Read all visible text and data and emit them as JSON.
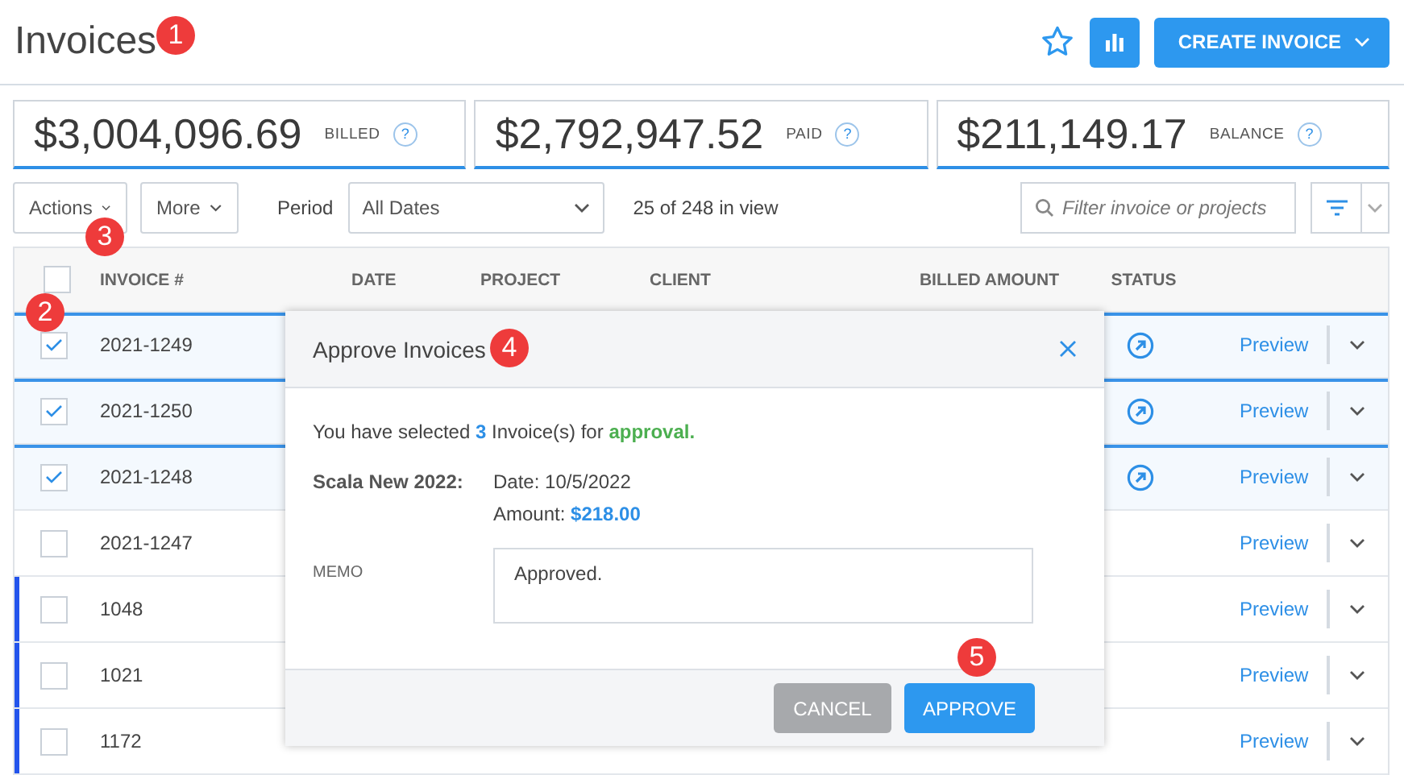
{
  "header": {
    "title": "Invoices",
    "favorite": false,
    "create_button": "CREATE INVOICE"
  },
  "stats": [
    {
      "amount": "$3,004,096.69",
      "label": "BILLED",
      "help": "?"
    },
    {
      "amount": "$2,792,947.52",
      "label": "PAID",
      "help": "?"
    },
    {
      "amount": "$211,149.17",
      "label": "BALANCE",
      "help": "?"
    }
  ],
  "toolbar": {
    "actions": "Actions",
    "more": "More",
    "period_label": "Period",
    "period_value": "All Dates",
    "count": "25 of 248 in view",
    "search": {
      "placeholder": "Filter invoice or projects"
    }
  },
  "table": {
    "header_checked": false,
    "columns": [
      "INVOICE #",
      "DATE",
      "PROJECT",
      "CLIENT",
      "BILLED AMOUNT",
      "STATUS"
    ],
    "rows": [
      {
        "invoice": "2021-1249",
        "checked": true,
        "flagged": false,
        "status_icon": true,
        "action": "Preview"
      },
      {
        "invoice": "2021-1250",
        "checked": true,
        "flagged": false,
        "status_icon": true,
        "action": "Preview"
      },
      {
        "invoice": "2021-1248",
        "checked": true,
        "flagged": false,
        "status_icon": true,
        "action": "Preview"
      },
      {
        "invoice": "2021-1247",
        "checked": false,
        "flagged": false,
        "status_icon": false,
        "action": "Preview"
      },
      {
        "invoice": "1048",
        "checked": false,
        "flagged": true,
        "status_icon": false,
        "action": "Preview"
      },
      {
        "invoice": "1021",
        "checked": false,
        "flagged": true,
        "status_icon": false,
        "action": "Preview"
      },
      {
        "invoice": "1172",
        "checked": false,
        "flagged": true,
        "status_icon": false,
        "action": "Preview"
      }
    ]
  },
  "dialog": {
    "title": "Approve Invoices",
    "message": "You have selected **3** Invoice(s) for **approval.**",
    "project": "Scala New 2022:",
    "date": "Date: 10/5/2022",
    "amount": "Amount: **$218.00**",
    "memo_label": "MEMO",
    "memo_value": "Approved.",
    "cancel": "CANCEL",
    "approve": "APPROVE"
  },
  "markers": [
    "1",
    "2",
    "3",
    "4",
    "5"
  ]
}
